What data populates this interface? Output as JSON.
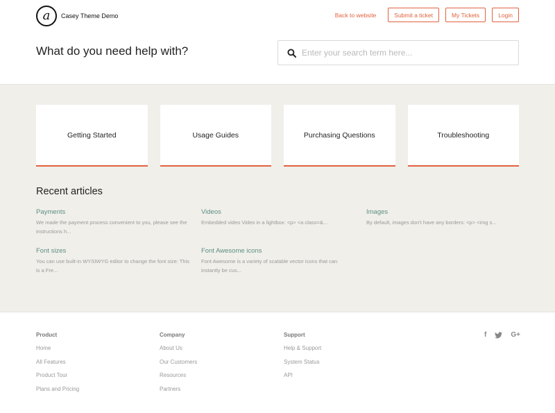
{
  "header": {
    "logo_glyph": "a",
    "brand": "Casey Theme Demo",
    "nav": {
      "back_link": "Back to website",
      "submit_ticket": "Submit a ticket",
      "my_tickets": "My Tickets",
      "login": "Login"
    },
    "hero_title": "What do you need help with?",
    "search": {
      "placeholder": "Enter your search term here..."
    }
  },
  "categories": [
    "Getting Started",
    "Usage Guides",
    "Purchasing Questions",
    "Troubleshooting"
  ],
  "recent": {
    "title": "Recent articles",
    "articles": [
      {
        "title": "Payments",
        "excerpt": "We made the payment process convenient to you, please see the instructions h..."
      },
      {
        "title": "Videos",
        "excerpt": "Embedded video Video in a lightbox: <p>   <a class=&..."
      },
      {
        "title": "Images",
        "excerpt": "By default, images don't have any borders: <p>   <img s..."
      },
      {
        "title": "Font sizes",
        "excerpt": "You can use built-in WYSIWYG editor to change the font size: This is a Fre..."
      },
      {
        "title": "Font Awesome icons",
        "excerpt": "Font Awesome is a variety of scalable vector icons that can instantly be cus..."
      }
    ]
  },
  "footer": {
    "columns": [
      {
        "title": "Product",
        "links": [
          "Home",
          "All Features",
          "Product Tour",
          "Plans and Pricing"
        ]
      },
      {
        "title": "Company",
        "links": [
          "About Us",
          "Our Customers",
          "Resources",
          "Partners"
        ]
      },
      {
        "title": "Support",
        "links": [
          "Help & Support",
          "System Status",
          "API"
        ]
      }
    ],
    "social": {
      "facebook": "f",
      "google": "G+"
    }
  },
  "colors": {
    "accent": "#e0613d",
    "link_teal": "#5e8e85",
    "background_band": "#f0efea"
  }
}
